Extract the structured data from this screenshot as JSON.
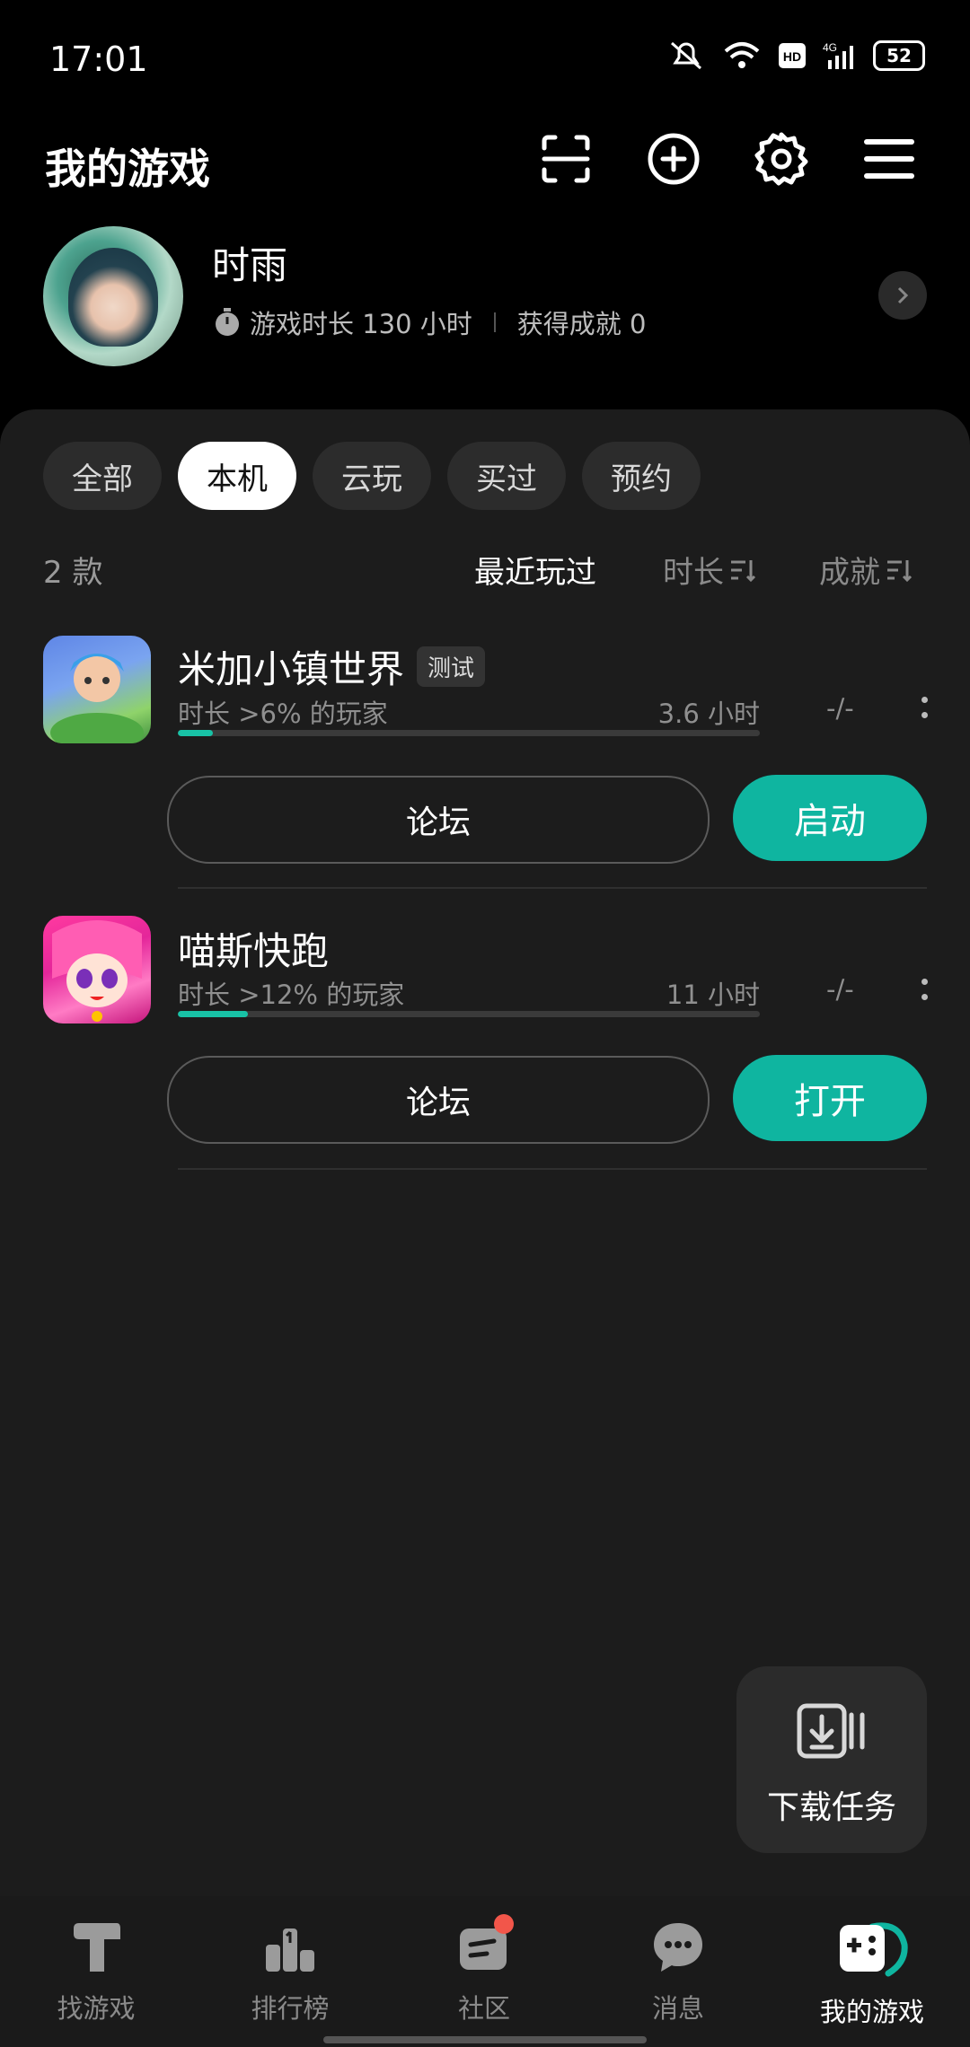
{
  "status": {
    "time": "17:01",
    "battery": "52"
  },
  "header": {
    "title": "我的游戏",
    "icons": [
      "scan-icon",
      "add-circle-icon",
      "gear-icon",
      "menu-icon"
    ]
  },
  "profile": {
    "name": "时雨",
    "playtime": "游戏时长 130 小时",
    "achievements": "获得成就 0"
  },
  "filters": [
    {
      "label": "全部",
      "active": false
    },
    {
      "label": "本机",
      "active": true
    },
    {
      "label": "云玩",
      "active": false
    },
    {
      "label": "买过",
      "active": false
    },
    {
      "label": "预约",
      "active": false
    }
  ],
  "list": {
    "count": "2 款",
    "sort_recent": "最近玩过",
    "sort_duration": "时长",
    "sort_achievement": "成就"
  },
  "games": [
    {
      "title": "米加小镇世界",
      "tag": "测试",
      "percentile": "时长 >6% 的玩家",
      "hours": "3.6 小时",
      "achievement": "-/-",
      "progress": 0.06,
      "forum": "论坛",
      "action": "启动"
    },
    {
      "title": "喵斯快跑",
      "tag": "",
      "percentile": "时长 >12% 的玩家",
      "hours": "11 小时",
      "achievement": "-/-",
      "progress": 0.12,
      "forum": "论坛",
      "action": "打开"
    }
  ],
  "download": {
    "label": "下载任务"
  },
  "nav": [
    {
      "label": "找游戏",
      "icon": "hammer-icon"
    },
    {
      "label": "排行榜",
      "icon": "ranking-icon"
    },
    {
      "label": "社区",
      "icon": "community-icon"
    },
    {
      "label": "消息",
      "icon": "chat-icon"
    },
    {
      "label": "我的游戏",
      "icon": "gamepad-icon",
      "active": true
    }
  ],
  "colors": {
    "accent": "#0fb5a0",
    "badge": "#f2564a"
  }
}
